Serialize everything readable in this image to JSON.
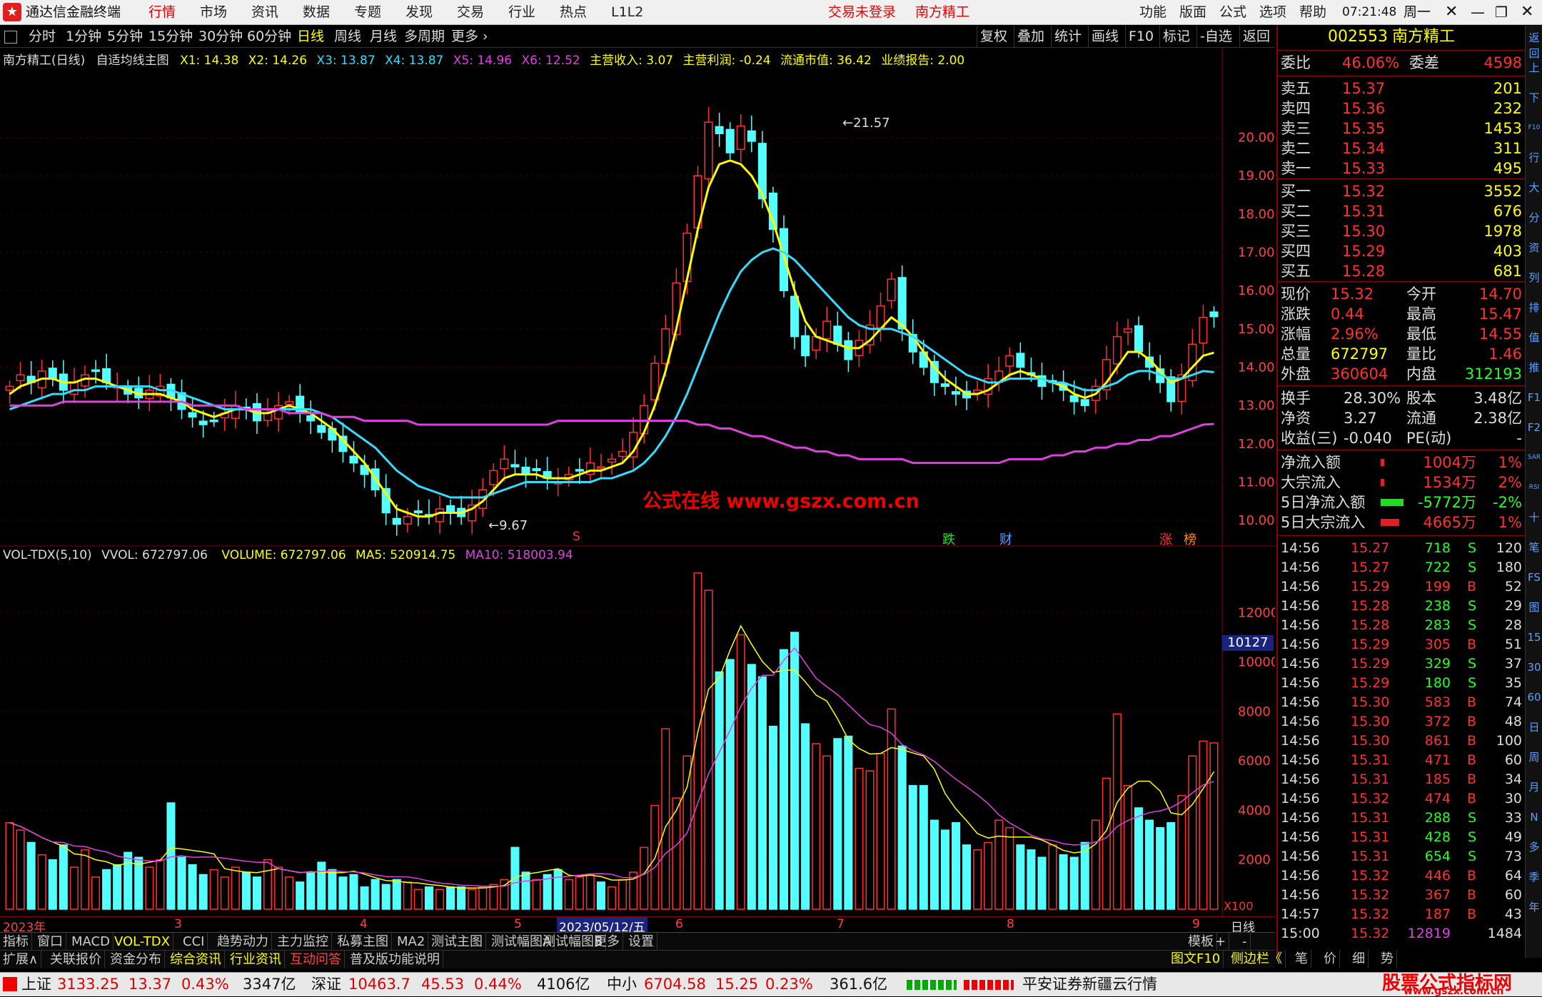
{
  "app": {
    "title": "通达信金融终端",
    "menu": [
      "行情",
      "市场",
      "资讯",
      "数据",
      "专题",
      "发现",
      "交易",
      "行业",
      "热点",
      "L1L2"
    ],
    "login_status": "交易未登录",
    "stock_name": "南方精工",
    "right_menu": [
      "功能",
      "版面",
      "公式",
      "选项",
      "帮助"
    ],
    "clock": "07:21:48",
    "weekday": "周一"
  },
  "periods": {
    "items": [
      "分时",
      "1分钟",
      "5分钟",
      "15分钟",
      "30分钟",
      "60分钟",
      "日线",
      "周线",
      "月线",
      "多周期",
      "更多"
    ],
    "selected": "日线",
    "right_buttons": [
      "复权",
      "叠加",
      "统计",
      "画线",
      "F10",
      "标记",
      "-自选",
      "返回"
    ]
  },
  "main_legend": {
    "name": "南方精工(日线)",
    "indicator": "自适均线主图",
    "x1": "X1: 14.38",
    "x2": "X2: 14.26",
    "x3": "X3: 13.87",
    "x4": "X4: 13.87",
    "x5": "X5: 14.96",
    "x6": "X6: 12.52",
    "revenue": "主营收入: 3.07",
    "profit": "主营利润: -0.24",
    "mktcap": "流通市值: 36.42",
    "report": "业绩报告: 2.00",
    "high_label": "21.57",
    "low_label": "9.67",
    "watermark": "公式在线 www.gszx.com.cn",
    "markers": [
      "S",
      "跌",
      "财",
      "涨",
      "榜"
    ]
  },
  "vol_legend": {
    "name": "VOL-TDX(5,10)",
    "vvol": "VVOL: 672797.06",
    "volume": "VOLUME: 672797.06",
    "ma5": "MA5: 520914.75",
    "ma10": "MA10: 518003.94",
    "cursor_value": "10127",
    "scale_unit": "X100"
  },
  "time_axis": [
    "2023年",
    "3",
    "4",
    "5",
    "2023/05/12/五",
    "6",
    "7",
    "8",
    "9",
    "日线"
  ],
  "chart_data": [
    {
      "type": "candlestick",
      "title": "南方精工(日线)",
      "y_ticks": [
        10.0,
        11.0,
        12.0,
        13.0,
        14.0,
        15.0,
        16.0,
        17.0,
        18.0,
        19.0,
        20.0
      ],
      "ylim": [
        9.5,
        21.8
      ],
      "close": [
        13.5,
        13.8,
        13.6,
        13.9,
        13.7,
        13.4,
        13.6,
        13.8,
        13.9,
        13.6,
        13.5,
        13.3,
        13.2,
        13.4,
        13.5,
        13.2,
        12.9,
        12.7,
        12.5,
        12.6,
        12.8,
        13.0,
        12.9,
        12.6,
        12.8,
        13.0,
        13.1,
        12.8,
        12.6,
        12.3,
        12.1,
        11.8,
        11.5,
        11.2,
        10.8,
        10.2,
        9.9,
        10.1,
        10.2,
        10.1,
        10.3,
        10.2,
        10.1,
        10.4,
        10.8,
        11.3,
        11.6,
        11.4,
        11.2,
        11.3,
        11.1,
        11.0,
        11.2,
        11.3,
        11.5,
        11.4,
        11.6,
        11.8,
        12.3,
        13.0,
        14.1,
        15.0,
        16.2,
        17.5,
        19.0,
        20.4,
        20.1,
        19.6,
        20.3,
        19.9,
        18.4,
        17.6,
        16.0,
        14.8,
        14.3,
        14.8,
        15.2,
        14.6,
        14.2,
        14.7,
        15.1,
        15.6,
        16.3,
        15.0,
        14.4,
        14.0,
        13.6,
        13.5,
        13.3,
        13.2,
        13.4,
        13.7,
        13.9,
        14.3,
        14.0,
        13.8,
        13.5,
        13.6,
        13.4,
        13.1,
        13.0,
        13.5,
        14.2,
        14.8,
        15.0,
        14.4,
        14.0,
        13.6,
        13.1,
        13.8,
        14.6,
        15.3,
        15.32
      ],
      "series": [
        {
          "name": "X1",
          "values": [
            13.3,
            13.5,
            13.6,
            13.7,
            13.7,
            13.6,
            13.6,
            13.7,
            13.7,
            13.6,
            13.5,
            13.4,
            13.3,
            13.3,
            13.3,
            13.2,
            13.1,
            12.9,
            12.8,
            12.7,
            12.8,
            12.9,
            12.9,
            12.8,
            12.8,
            12.9,
            13.0,
            12.9,
            12.8,
            12.6,
            12.4,
            12.1,
            11.8,
            11.5,
            11.1,
            10.7,
            10.3,
            10.2,
            10.1,
            10.1,
            10.2,
            10.2,
            10.2,
            10.3,
            10.5,
            10.8,
            11.1,
            11.2,
            11.2,
            11.2,
            11.1,
            11.1,
            11.1,
            11.2,
            11.3,
            11.3,
            11.4,
            11.5,
            11.8,
            12.3,
            13.0,
            13.9,
            15.0,
            16.3,
            17.6,
            18.7,
            19.3,
            19.4,
            19.3,
            19.0,
            18.5,
            17.8,
            16.9,
            16.0,
            15.2,
            14.8,
            14.7,
            14.6,
            14.5,
            14.5,
            14.7,
            15.0,
            15.3,
            15.1,
            14.8,
            14.4,
            14.0,
            13.7,
            13.5,
            13.3,
            13.3,
            13.4,
            13.6,
            13.8,
            13.9,
            13.8,
            13.7,
            13.6,
            13.5,
            13.3,
            13.2,
            13.3,
            13.6,
            14.0,
            14.4,
            14.4,
            14.2,
            13.9,
            13.6,
            13.7,
            14.0,
            14.3,
            14.38
          ]
        },
        {
          "name": "X3",
          "values": [
            12.9,
            13.0,
            13.1,
            13.2,
            13.3,
            13.3,
            13.4,
            13.4,
            13.5,
            13.5,
            13.5,
            13.5,
            13.5,
            13.5,
            13.4,
            13.4,
            13.3,
            13.2,
            13.1,
            13.0,
            12.9,
            12.9,
            12.9,
            12.9,
            12.9,
            12.9,
            12.9,
            12.9,
            12.9,
            12.8,
            12.7,
            12.5,
            12.3,
            12.1,
            11.9,
            11.6,
            11.3,
            11.1,
            10.9,
            10.8,
            10.7,
            10.6,
            10.6,
            10.6,
            10.6,
            10.7,
            10.8,
            10.9,
            11.0,
            11.0,
            11.0,
            11.0,
            11.0,
            11.0,
            11.0,
            11.1,
            11.1,
            11.2,
            11.3,
            11.5,
            11.8,
            12.2,
            12.7,
            13.3,
            14.0,
            14.7,
            15.4,
            16.0,
            16.5,
            16.8,
            17.0,
            17.1,
            17.0,
            16.8,
            16.5,
            16.2,
            15.9,
            15.6,
            15.3,
            15.1,
            15.0,
            15.0,
            15.0,
            14.9,
            14.8,
            14.6,
            14.4,
            14.2,
            14.0,
            13.8,
            13.7,
            13.6,
            13.6,
            13.7,
            13.7,
            13.7,
            13.7,
            13.6,
            13.6,
            13.5,
            13.4,
            13.4,
            13.5,
            13.6,
            13.8,
            13.9,
            13.9,
            13.8,
            13.7,
            13.7,
            13.8,
            13.9,
            13.87
          ]
        },
        {
          "name": "X6",
          "values": [
            13.0,
            13.0,
            13.0,
            13.0,
            13.0,
            13.1,
            13.1,
            13.1,
            13.1,
            13.1,
            13.1,
            13.1,
            13.1,
            13.1,
            13.1,
            13.1,
            13.1,
            13.0,
            13.0,
            13.0,
            13.0,
            13.0,
            12.9,
            12.9,
            12.9,
            12.9,
            12.8,
            12.8,
            12.8,
            12.8,
            12.7,
            12.7,
            12.7,
            12.6,
            12.6,
            12.6,
            12.6,
            12.6,
            12.5,
            12.5,
            12.5,
            12.5,
            12.5,
            12.5,
            12.5,
            12.5,
            12.5,
            12.5,
            12.5,
            12.5,
            12.5,
            12.6,
            12.6,
            12.6,
            12.6,
            12.6,
            12.6,
            12.6,
            12.6,
            12.6,
            12.6,
            12.6,
            12.6,
            12.6,
            12.5,
            12.5,
            12.4,
            12.4,
            12.3,
            12.2,
            12.2,
            12.1,
            12.0,
            11.9,
            11.9,
            11.8,
            11.8,
            11.7,
            11.7,
            11.6,
            11.6,
            11.6,
            11.6,
            11.6,
            11.5,
            11.5,
            11.5,
            11.5,
            11.5,
            11.5,
            11.5,
            11.5,
            11.5,
            11.6,
            11.6,
            11.6,
            11.6,
            11.7,
            11.7,
            11.8,
            11.8,
            11.9,
            11.9,
            12.0,
            12.0,
            12.1,
            12.1,
            12.2,
            12.2,
            12.3,
            12.4,
            12.5,
            12.52
          ]
        }
      ]
    },
    {
      "type": "bar",
      "title": "VOL-TDX(5,10)",
      "y_ticks": [
        2000,
        4000,
        6000,
        8000,
        10000,
        12000
      ],
      "ylim": [
        0,
        13800
      ],
      "values": [
        3500,
        3200,
        2700,
        2200,
        2000,
        2600,
        1700,
        2400,
        1300,
        1600,
        1800,
        2300,
        2100,
        1700,
        2000,
        4300,
        2100,
        1800,
        1400,
        1600,
        1300,
        1700,
        1500,
        1300,
        2000,
        1700,
        1300,
        1100,
        1500,
        1900,
        1600,
        1300,
        1400,
        900,
        1200,
        1000,
        1200,
        1100,
        800,
        900,
        800,
        900,
        900,
        800,
        900,
        1000,
        1200,
        2500,
        1500,
        1200,
        1400,
        1600,
        1200,
        1300,
        1400,
        1100,
        900,
        1200,
        1500,
        2500,
        4200,
        7300,
        4500,
        6200,
        13600,
        12900,
        9600,
        10100,
        11100,
        9900,
        9400,
        7400,
        10500,
        11200,
        7500,
        6700,
        6200,
        6900,
        7000,
        5700,
        5600,
        6300,
        8100,
        6600,
        5000,
        5000,
        3600,
        3200,
        3500,
        2600,
        2400,
        2700,
        3600,
        3300,
        2600,
        2400,
        2100,
        2600,
        2200,
        2100,
        2700,
        3600,
        5300,
        7900,
        5000,
        4100,
        3600,
        3300,
        3500,
        4600,
        6200,
        6800,
        6727.97
      ]
    }
  ],
  "quote": {
    "code": "002553",
    "name": "南方精工",
    "weibi_label": "委比",
    "weibi": "46.06%",
    "weicha_label": "委差",
    "weicha": "4598",
    "asks": [
      {
        "label": "卖五",
        "price": "15.37",
        "vol": "201"
      },
      {
        "label": "卖四",
        "price": "15.36",
        "vol": "232"
      },
      {
        "label": "卖三",
        "price": "15.35",
        "vol": "1453"
      },
      {
        "label": "卖二",
        "price": "15.34",
        "vol": "311"
      },
      {
        "label": "卖一",
        "price": "15.33",
        "vol": "495"
      }
    ],
    "bids": [
      {
        "label": "买一",
        "price": "15.32",
        "vol": "3552"
      },
      {
        "label": "买二",
        "price": "15.31",
        "vol": "676"
      },
      {
        "label": "买三",
        "price": "15.30",
        "vol": "1978"
      },
      {
        "label": "买四",
        "price": "15.29",
        "vol": "403"
      },
      {
        "label": "买五",
        "price": "15.28",
        "vol": "681"
      }
    ],
    "stats": [
      {
        "l1": "现价",
        "v1": "15.32",
        "l2": "今开",
        "v2": "14.70"
      },
      {
        "l1": "涨跌",
        "v1": "0.44",
        "l2": "最高",
        "v2": "15.47"
      },
      {
        "l1": "涨幅",
        "v1": "2.96%",
        "l2": "最低",
        "v2": "14.55"
      },
      {
        "l1": "总量",
        "v1": "672797",
        "l2": "量比",
        "v2": "1.46"
      },
      {
        "l1": "外盘",
        "v1": "360604",
        "l2": "内盘",
        "v2": "312193"
      }
    ],
    "stats2": [
      {
        "l1": "换手",
        "v1": "28.30%",
        "l2": "股本",
        "v2": "3.48亿"
      },
      {
        "l1": "净资",
        "v1": "3.27",
        "l2": "流通",
        "v2": "2.38亿"
      },
      {
        "l1": "收益(三)",
        "v1": "-0.040",
        "l2": "PE(动)",
        "v2": "-"
      }
    ],
    "flows": [
      {
        "label": "净流入额",
        "value": "1004万",
        "pct": "1%",
        "bar": 0.05
      },
      {
        "label": "大宗流入",
        "value": "1534万",
        "pct": "2%",
        "bar": 0.05
      },
      {
        "label": "5日净流入额",
        "value": "-5772万",
        "pct": "-2%",
        "bar": 0.8
      },
      {
        "label": "5日大宗流入",
        "value": "4665万",
        "pct": "1%",
        "bar": 0.65
      }
    ]
  },
  "ticks": [
    {
      "t": "14:56",
      "p": "15.27",
      "v": "718",
      "d": "S",
      "n": "120"
    },
    {
      "t": "14:56",
      "p": "15.27",
      "v": "722",
      "d": "S",
      "n": "180"
    },
    {
      "t": "14:56",
      "p": "15.29",
      "v": "199",
      "d": "B",
      "n": "52"
    },
    {
      "t": "14:56",
      "p": "15.28",
      "v": "238",
      "d": "S",
      "n": "29"
    },
    {
      "t": "14:56",
      "p": "15.28",
      "v": "283",
      "d": "S",
      "n": "28"
    },
    {
      "t": "14:56",
      "p": "15.29",
      "v": "305",
      "d": "B",
      "n": "51"
    },
    {
      "t": "14:56",
      "p": "15.29",
      "v": "329",
      "d": "S",
      "n": "37"
    },
    {
      "t": "14:56",
      "p": "15.29",
      "v": "180",
      "d": "S",
      "n": "35"
    },
    {
      "t": "14:56",
      "p": "15.30",
      "v": "583",
      "d": "B",
      "n": "74"
    },
    {
      "t": "14:56",
      "p": "15.30",
      "v": "372",
      "d": "B",
      "n": "48"
    },
    {
      "t": "14:56",
      "p": "15.30",
      "v": "861",
      "d": "B",
      "n": "100"
    },
    {
      "t": "14:56",
      "p": "15.31",
      "v": "471",
      "d": "B",
      "n": "60"
    },
    {
      "t": "14:56",
      "p": "15.31",
      "v": "185",
      "d": "B",
      "n": "34"
    },
    {
      "t": "14:56",
      "p": "15.32",
      "v": "474",
      "d": "B",
      "n": "30"
    },
    {
      "t": "14:56",
      "p": "15.31",
      "v": "288",
      "d": "S",
      "n": "33"
    },
    {
      "t": "14:56",
      "p": "15.31",
      "v": "428",
      "d": "S",
      "n": "49"
    },
    {
      "t": "14:56",
      "p": "15.31",
      "v": "654",
      "d": "S",
      "n": "73"
    },
    {
      "t": "14:56",
      "p": "15.32",
      "v": "446",
      "d": "B",
      "n": "64"
    },
    {
      "t": "14:56",
      "p": "15.32",
      "v": "367",
      "d": "B",
      "n": "60"
    },
    {
      "t": "14:57",
      "p": "15.32",
      "v": "187",
      "d": "B",
      "n": "43"
    },
    {
      "t": "15:00",
      "p": "15.32",
      "v": "12819",
      "d": "",
      "n": "1484"
    }
  ],
  "tabs1": [
    "指标",
    "窗口",
    "MACD",
    "VOL-TDX",
    "CCI",
    "趋势动力",
    "主力监控",
    "私募主图",
    "MA2",
    "测试主图",
    "测试幅图A",
    "测试幅图B",
    "更多",
    "设置"
  ],
  "tabs1_selected": "VOL-TDX",
  "tabs1_right": [
    "模板",
    "+",
    "-"
  ],
  "tabs2": [
    "扩展∧",
    "关联报价",
    "资金分布",
    "综合资讯",
    "行业资讯",
    "互动问答",
    "普及版功能说明"
  ],
  "tabs2_right": [
    "图文F10",
    "侧边栏《",
    "笔",
    "价",
    "细",
    "势"
  ],
  "status": {
    "sh": {
      "name": "上证",
      "val": "3133.25",
      "chg": "13.37",
      "pct": "0.43%",
      "amt": "3347亿"
    },
    "sz": {
      "name": "深证",
      "val": "10463.7",
      "chg": "45.53",
      "pct": "0.44%",
      "amt": "4106亿"
    },
    "zx": {
      "name": "中小",
      "val": "6704.58",
      "chg": "15.25",
      "pct": "0.23%",
      "amt": "361.6亿"
    },
    "broker": "平安证券新疆云行情",
    "brand": "股票公式指标网",
    "brand_url": "www.gszx.com.cn"
  },
  "side_icons": [
    "返回",
    "上",
    "下",
    "F10",
    "行",
    "大",
    "分",
    "资",
    "列",
    "排",
    "值",
    "推",
    "F1",
    "F2",
    "SAR",
    "RSI",
    "十",
    "笔",
    "FS",
    "图",
    "15",
    "30",
    "60",
    "日",
    "周",
    "月",
    "N",
    "多",
    "季",
    "年"
  ],
  "colors": {
    "up": "#ff3030",
    "down": "#54ffff",
    "x1": "#ffff00",
    "x3": "#33ddff",
    "x6": "#e040e0",
    "ma5": "#ffff00",
    "ma10": "#e040e0",
    "grid": "#8b0000"
  }
}
